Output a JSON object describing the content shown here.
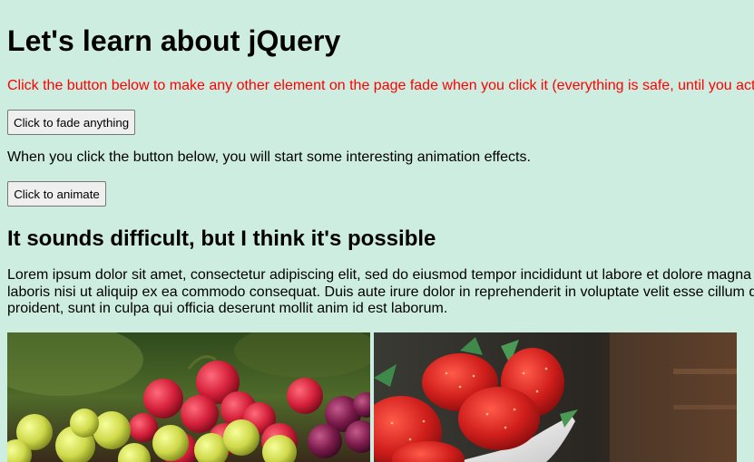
{
  "heading": "Let's learn about jQuery",
  "fade_notice": "Click the button below to make any other element on the page fade when you click it (everything is safe, until you act",
  "fade_button_label": "Click to fade anything",
  "animate_info": "When you click the button below, you will start some interesting animation effects.",
  "animate_button_label": "Click to animate",
  "subheading": "It sounds difficult, but I think it's possible",
  "lorem_lines": [
    "Lorem ipsum dolor sit amet, consectetur adipiscing elit, sed do eiusmod tempor incididunt ut labore et dolore magna",
    "laboris nisi ut aliquip ex ea commodo consequat. Duis aute irure dolor in reprehenderit in voluptate velit esse cillum d",
    "proident, sunt in culpa qui officia deserunt mollit anim id est laborum."
  ],
  "images": {
    "left": "grapes-photo",
    "right": "strawberries-photo"
  },
  "colors": {
    "background": "#cdede0",
    "notice_text": "#ff0000"
  }
}
